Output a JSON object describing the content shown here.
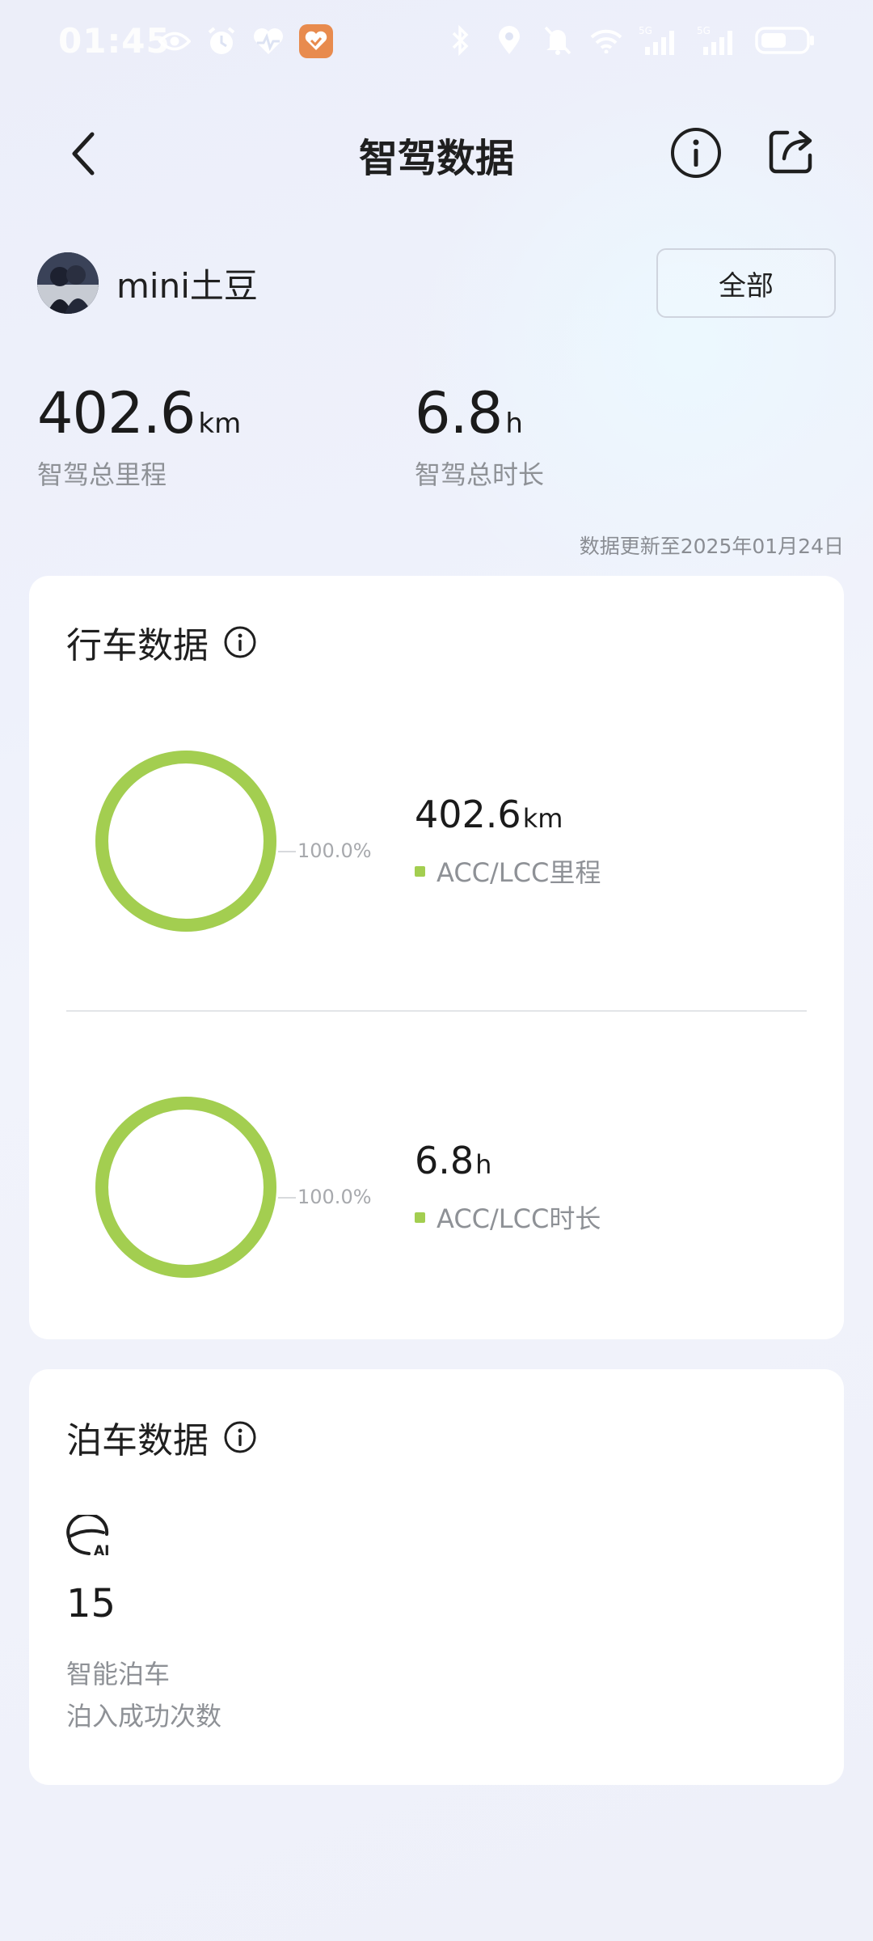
{
  "status_bar": {
    "time": "01:45",
    "left_icons": [
      "eye-icon",
      "alarm-icon",
      "health-icon",
      "app-badge-icon"
    ],
    "right_icons": [
      "bluetooth-icon",
      "location-icon",
      "mute-icon",
      "wifi-icon",
      "signal-5g-icon",
      "signal-5g-icon",
      "battery-icon"
    ]
  },
  "nav": {
    "title": "智驾数据"
  },
  "user": {
    "name": "mini土豆",
    "filter_button": "全部"
  },
  "totals": {
    "mileage_value": "402.6",
    "mileage_unit": "km",
    "mileage_label": "智驾总里程",
    "duration_value": "6.8",
    "duration_unit": "h",
    "duration_label": "智驾总时长",
    "updated": "数据更新至2025年01月24日"
  },
  "driving": {
    "title": "行车数据",
    "mileage": {
      "percent": "100.0%",
      "value": "402.6",
      "unit": "km",
      "legend": "ACC/LCC里程",
      "fraction": 1.0
    },
    "duration": {
      "percent": "100.0%",
      "value": "6.8",
      "unit": "h",
      "legend": "ACC/LCC时长",
      "fraction": 1.0
    }
  },
  "parking": {
    "title": "泊车数据",
    "icon": "ai-parking-icon",
    "count": "15",
    "label_line1": "智能泊车",
    "label_line2": "泊入成功次数"
  },
  "colors": {
    "ring": "#a3ce50",
    "text_primary": "#1b1b1b",
    "text_secondary": "#8e9196"
  }
}
